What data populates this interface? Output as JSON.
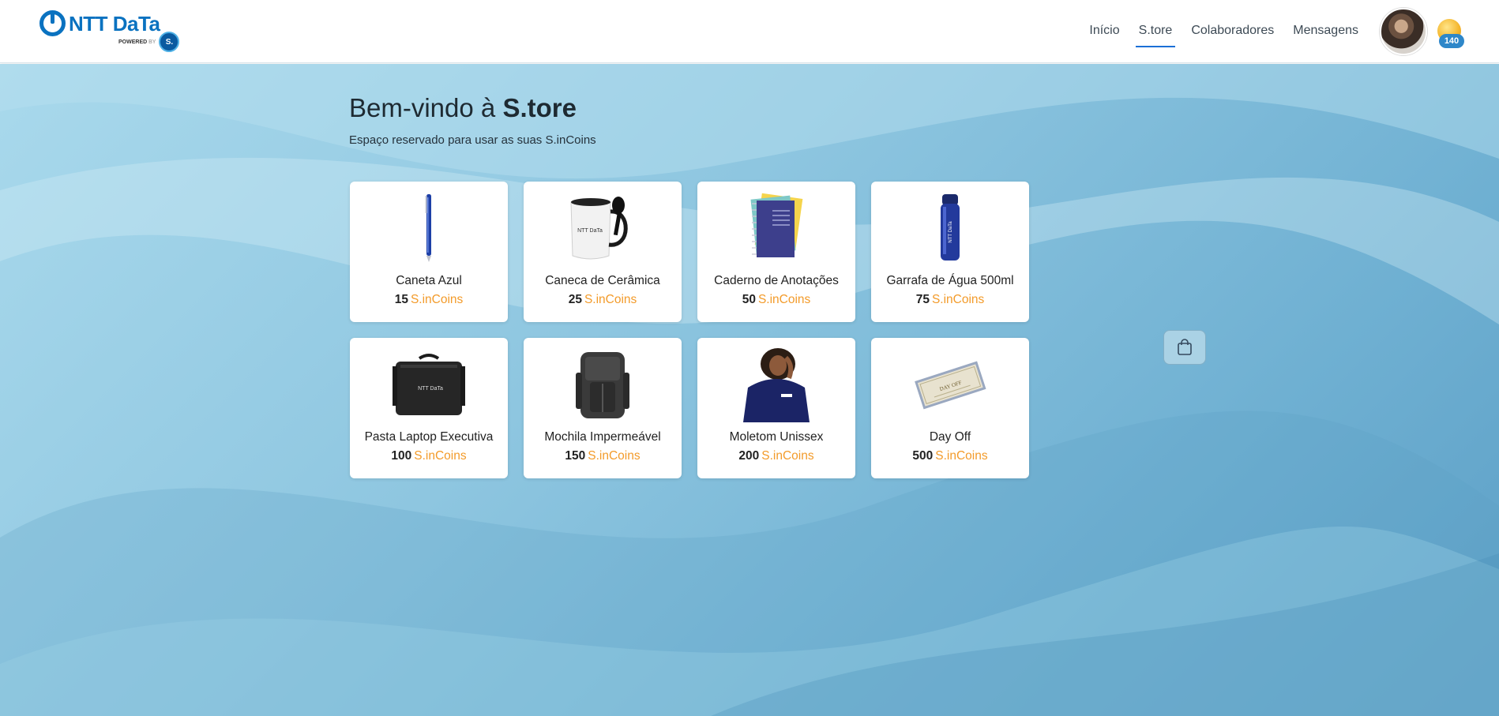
{
  "header": {
    "logo_text": "NTT DaTa",
    "powered_label": "POWERED",
    "powered_by": "BY",
    "powered_badge": "S.",
    "nav": [
      {
        "label": "Início",
        "active": false
      },
      {
        "label": "S.tore",
        "active": true
      },
      {
        "label": "Colaboradores",
        "active": false
      },
      {
        "label": "Mensagens",
        "active": false
      }
    ],
    "coin_count": "140"
  },
  "main": {
    "title_prefix": "Bem-vindo à ",
    "title_brand": "S.tore",
    "subtitle": "Espaço reservado para usar as suas S.inCoins"
  },
  "products": [
    {
      "name": "Caneta Azul",
      "price": "15",
      "currency": "S.inCoins",
      "icon": "pen-image"
    },
    {
      "name": "Caneca de Cerâmica",
      "price": "25",
      "currency": "S.inCoins",
      "icon": "mug-image"
    },
    {
      "name": "Caderno de Anotações",
      "price": "50",
      "currency": "S.inCoins",
      "icon": "notebook-image"
    },
    {
      "name": "Garrafa de Água 500ml",
      "price": "75",
      "currency": "S.inCoins",
      "icon": "bottle-image"
    },
    {
      "name": "Pasta Laptop Executiva",
      "price": "100",
      "currency": "S.inCoins",
      "icon": "laptop-bag-image"
    },
    {
      "name": "Mochila Impermeável",
      "price": "150",
      "currency": "S.inCoins",
      "icon": "backpack-image"
    },
    {
      "name": "Moletom Unissex",
      "price": "200",
      "currency": "S.inCoins",
      "icon": "hoodie-image"
    },
    {
      "name": "Day Off",
      "price": "500",
      "currency": "S.inCoins",
      "icon": "voucher-image",
      "image_text": "DAY OFF"
    }
  ],
  "cart": {
    "icon": "shopping-bag-icon"
  },
  "colors": {
    "accent": "#1b6fd6",
    "currency": "#f39b2a",
    "brand": "#0a72c0"
  }
}
